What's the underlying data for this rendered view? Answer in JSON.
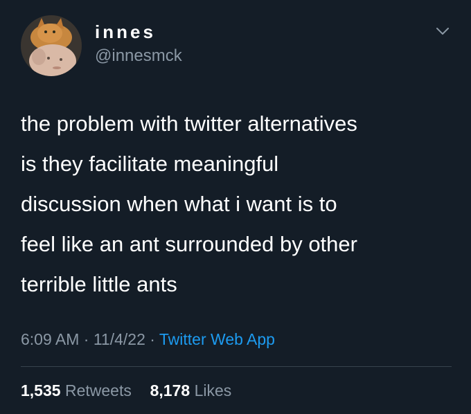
{
  "author": {
    "display_name": "innes",
    "handle": "@innesmck",
    "avatar_icon": "avatar-cat-and-person"
  },
  "menu_icon": "chevron-down-icon",
  "tweet": {
    "text": "the problem with twitter alternatives\nis they facilitate meaningful\ndiscussion when what i want is to\nfeel like an ant surrounded by other\nterrible little ants"
  },
  "meta": {
    "time": "6:09 AM",
    "separator": " · ",
    "date": "11/4/22",
    "source": "Twitter Web App"
  },
  "stats": {
    "retweets_count": "1,535",
    "retweets_label": "Retweets",
    "likes_count": "8,178",
    "likes_label": "Likes"
  },
  "colors": {
    "background": "#141d27",
    "secondary_text": "#8b98a5",
    "link": "#1d9bf0",
    "divider": "#38444d"
  }
}
